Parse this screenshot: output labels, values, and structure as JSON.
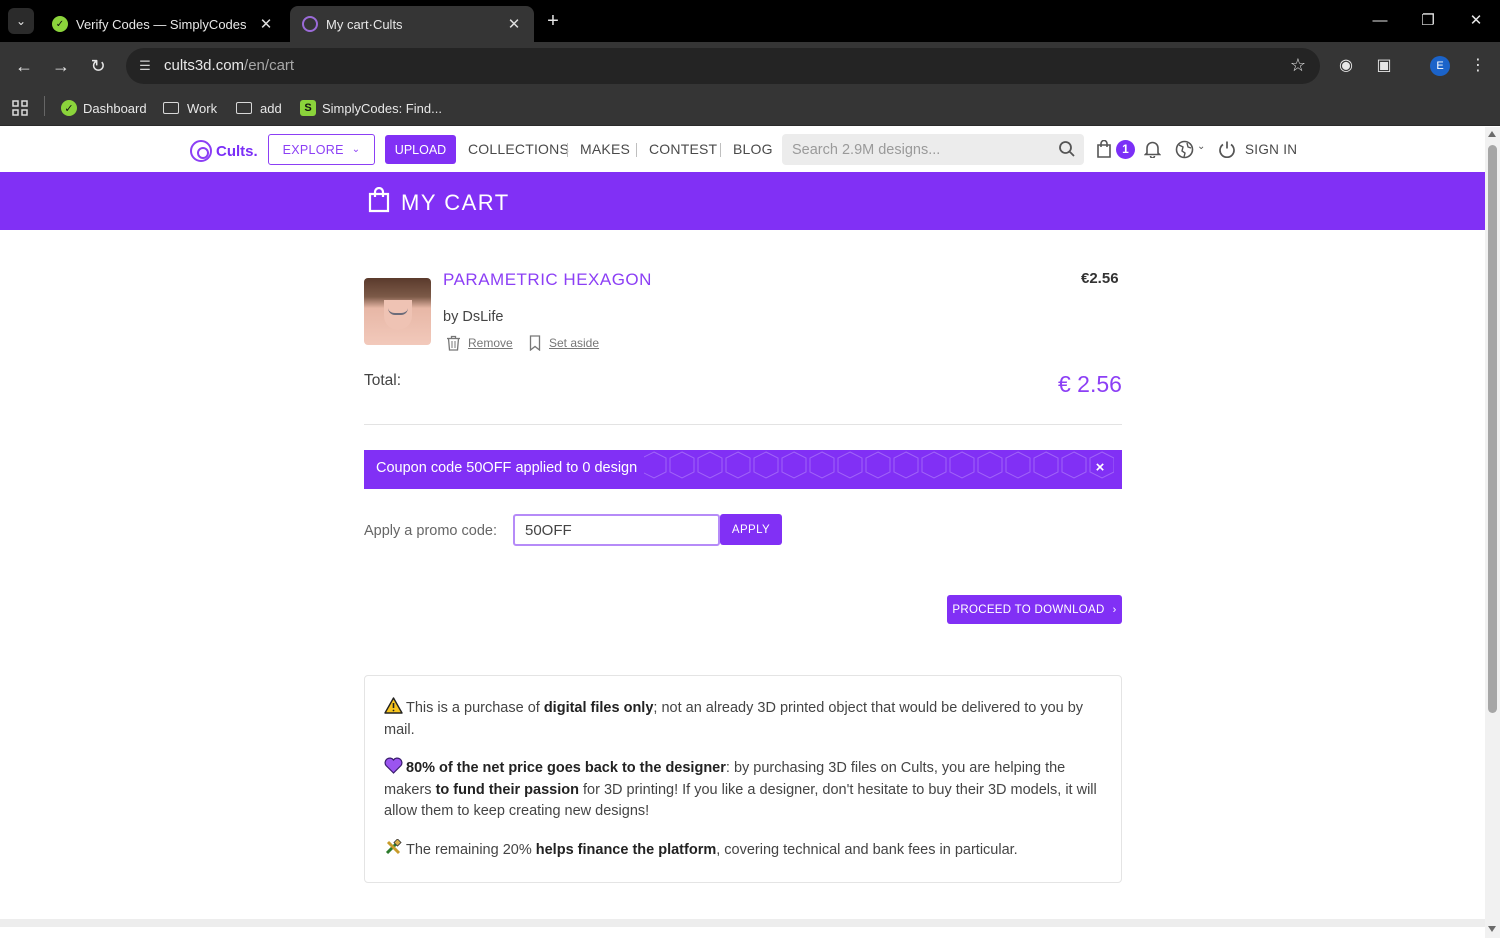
{
  "browser": {
    "tabs": [
      {
        "title": "Verify Codes — SimplyCodes",
        "active": false
      },
      {
        "title": "My cart·Cults",
        "active": true
      }
    ],
    "url_host": "cults3d.com",
    "url_path": "/en/cart",
    "profile_initial": "E",
    "bookmarks": [
      {
        "label": "Dashboard"
      },
      {
        "label": "Work"
      },
      {
        "label": "add"
      },
      {
        "label": "SimplyCodes: Find..."
      }
    ]
  },
  "site": {
    "logo_text": "Cults.",
    "explore_label": "EXPLORE",
    "upload_label": "UPLOAD",
    "nav_links": [
      "COLLECTIONS",
      "MAKES",
      "CONTEST",
      "BLOG"
    ],
    "search_placeholder": "Search 2.9M designs...",
    "cart_count": "1",
    "signin_label": "SIGN IN"
  },
  "cart": {
    "title": "MY CART",
    "item": {
      "name": "PARAMETRIC HEXAGON",
      "author": "by DsLife",
      "price": "€2.56",
      "remove_label": "Remove",
      "set_aside_label": "Set aside"
    },
    "total_label": "Total:",
    "total_value": "€ 2.56",
    "coupon_message": "Coupon code 50OFF applied to 0 design",
    "coupon_close": "×",
    "promo_label": "Apply a promo code:",
    "promo_value": "50OFF",
    "apply_label": "APPLY",
    "proceed_label": "PROCEED TO DOWNLOAD"
  },
  "info": {
    "p1_pre": "This is a purchase of ",
    "p1_bold": "digital files only",
    "p1_post": "; not an already 3D printed object that would be delivered to you by mail.",
    "p2_bold1": "80% of the net price goes back to the designer",
    "p2_mid": ": by purchasing 3D files on Cults, you are helping the makers ",
    "p2_bold2": "to fund their passion",
    "p2_post": " for 3D printing! If you like a designer, don't hesitate to buy their 3D models, it will allow them to keep creating new designs!",
    "p3_pre": "The remaining 20% ",
    "p3_bold": "helps finance the platform",
    "p3_post": ", covering technical and bank fees in particular."
  },
  "colors": {
    "brand": "#8130f5",
    "brand_text": "#8c3ff5"
  }
}
